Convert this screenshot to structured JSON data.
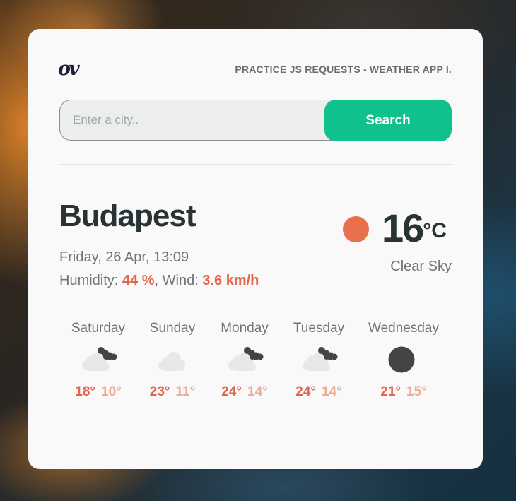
{
  "header": {
    "logo_text": "ov",
    "app_title": "PRACTICE JS REQUESTS - WEATHER APP I."
  },
  "search": {
    "placeholder": "Enter a city..",
    "value": "",
    "button_label": "Search"
  },
  "current": {
    "city": "Budapest",
    "datetime": "Friday, 26 Apr, 13:09",
    "humidity_label": "Humidity:",
    "humidity_value": "44 %",
    "wind_label": ", Wind:",
    "wind_value": "3.6 km/h",
    "temperature": "16",
    "unit": "°C",
    "condition": "Clear Sky",
    "icon": "sun-icon",
    "icon_color": "#e8704d"
  },
  "forecast": [
    {
      "day": "Saturday",
      "icon": "cloud-dark-icon",
      "high": "18°",
      "low": "10°"
    },
    {
      "day": "Sunday",
      "icon": "cloud-icon",
      "high": "23°",
      "low": "11°"
    },
    {
      "day": "Monday",
      "icon": "cloud-dark-icon",
      "high": "24°",
      "low": "14°"
    },
    {
      "day": "Tuesday",
      "icon": "cloud-dark-icon",
      "high": "24°",
      "low": "14°"
    },
    {
      "day": "Wednesday",
      "icon": "moon-icon",
      "high": "21°",
      "low": "15°"
    }
  ],
  "colors": {
    "accent": "#10c18d",
    "highlight": "#e4654d",
    "low_temp": "#efaa95",
    "text_dark": "#283333"
  }
}
